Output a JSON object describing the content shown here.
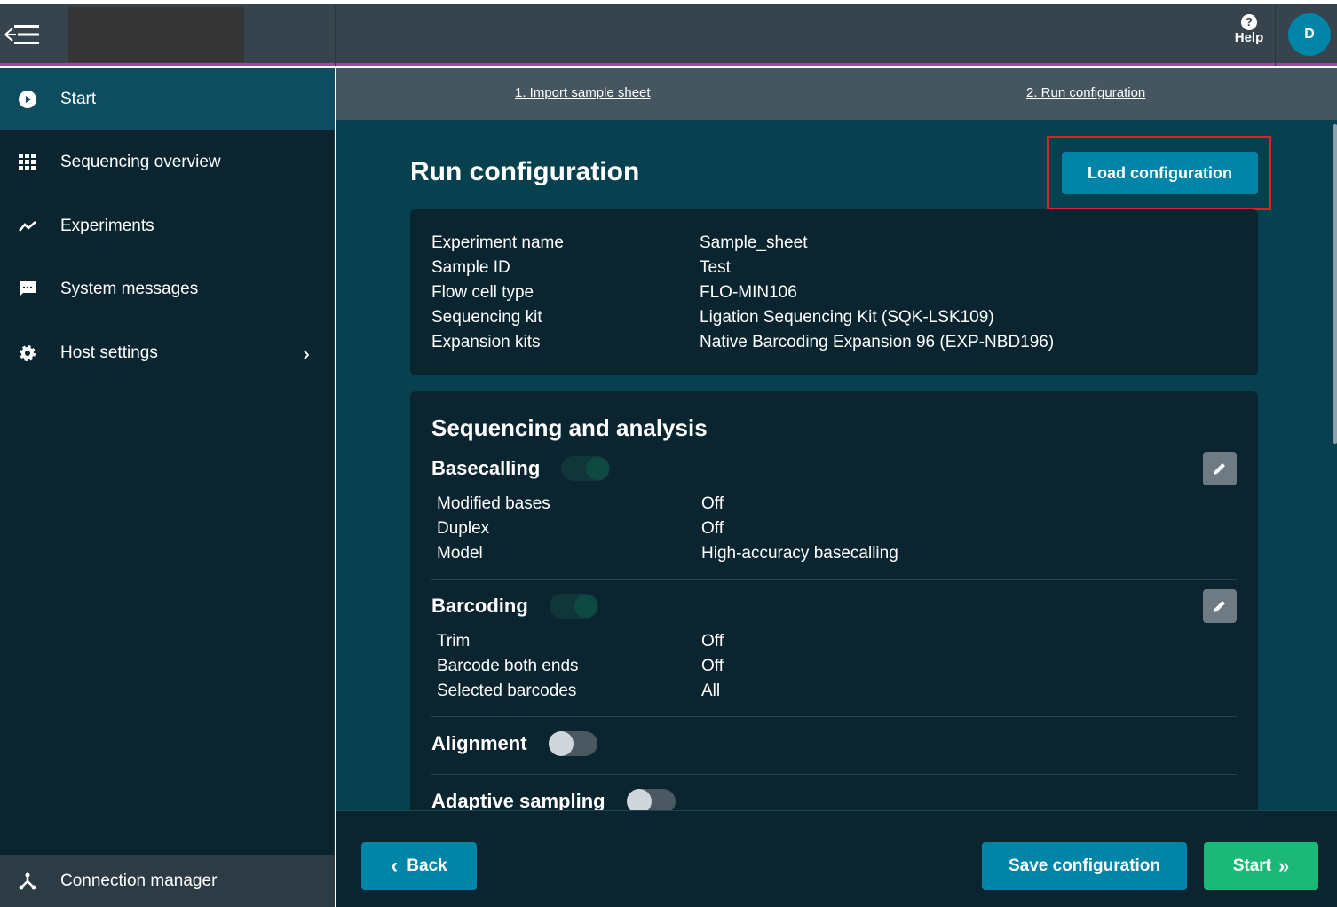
{
  "header": {
    "help_label": "Help",
    "help_icon": "question-circle-icon",
    "avatar_initial": "D"
  },
  "sidebar": {
    "items": [
      {
        "label": "Start",
        "icon": "play-circle-icon",
        "active": true
      },
      {
        "label": "Sequencing overview",
        "icon": "grid-icon"
      },
      {
        "label": "Experiments",
        "icon": "line-chart-icon"
      },
      {
        "label": "System messages",
        "icon": "message-icon"
      },
      {
        "label": "Host settings",
        "icon": "gear-icon"
      }
    ],
    "connection_manager": "Connection manager"
  },
  "steps": [
    "1. Import sample sheet",
    "2. Run configuration"
  ],
  "main": {
    "title": "Run configuration",
    "load_button": "Load configuration",
    "summary": [
      {
        "k": "Experiment name",
        "v": "Sample_sheet"
      },
      {
        "k": "Sample ID",
        "v": "Test"
      },
      {
        "k": "Flow cell type",
        "v": "FLO-MIN106"
      },
      {
        "k": "Sequencing kit",
        "v": "Ligation Sequencing Kit (SQK-LSK109)"
      },
      {
        "k": "Expansion kits",
        "v": "Native Barcoding Expansion 96 (EXP-NBD196)"
      }
    ],
    "analysis": {
      "title": "Sequencing and analysis",
      "basecalling": {
        "label": "Basecalling",
        "enabled": true,
        "rows": [
          {
            "k": "Modified bases",
            "v": "Off"
          },
          {
            "k": "Duplex",
            "v": "Off"
          },
          {
            "k": "Model",
            "v": "High-accuracy basecalling"
          }
        ]
      },
      "barcoding": {
        "label": "Barcoding",
        "enabled": true,
        "rows": [
          {
            "k": "Trim",
            "v": "Off"
          },
          {
            "k": "Barcode both ends",
            "v": "Off"
          },
          {
            "k": "Selected barcodes",
            "v": "All"
          }
        ]
      },
      "alignment": {
        "label": "Alignment",
        "enabled": false
      },
      "adaptive": {
        "label": "Adaptive sampling",
        "enabled": false
      }
    }
  },
  "footer": {
    "back": "Back",
    "save": "Save configuration",
    "start": "Start"
  },
  "colors": {
    "accent": "#0085a8",
    "start_green": "#1ab977",
    "highlight": "#e01f2b",
    "header_rule": "#9b4a9c"
  }
}
